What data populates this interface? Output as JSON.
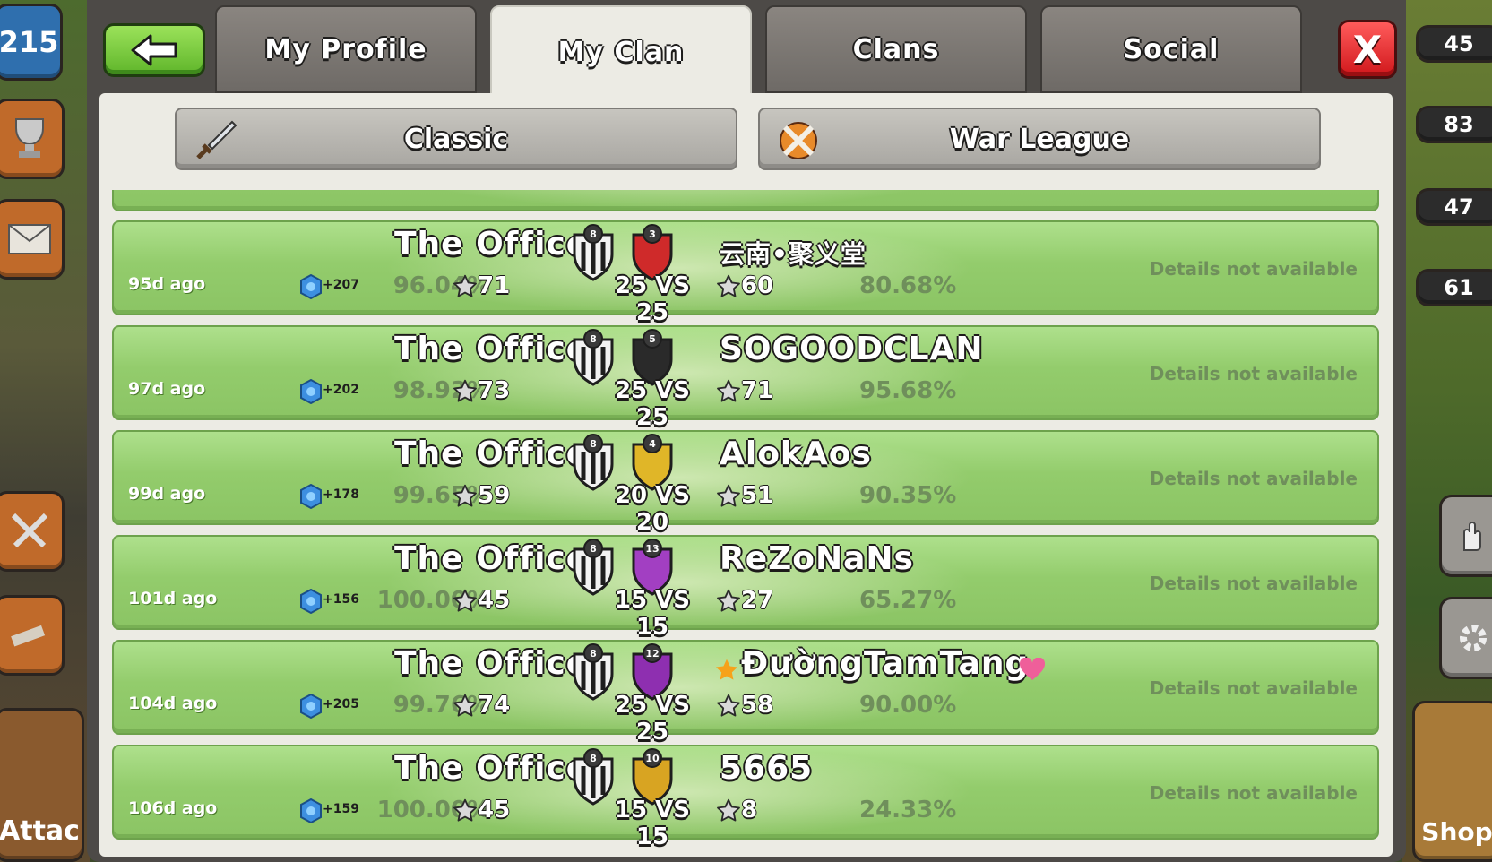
{
  "header": {
    "tabs": [
      {
        "label": "My Profile",
        "active": false
      },
      {
        "label": "My Clan",
        "active": true
      },
      {
        "label": "Clans",
        "active": false
      },
      {
        "label": "Social",
        "active": false
      }
    ],
    "close_label": "X"
  },
  "side_left": {
    "trophies_partial": "215",
    "attack_label_partial": "Attac"
  },
  "side_right": {
    "values_partial": [
      "45",
      "83",
      "47",
      "61"
    ],
    "shop_label_partial": "Shop"
  },
  "subtabs": [
    {
      "label": "Classic",
      "icon": "sword-icon"
    },
    {
      "label": "War League",
      "icon": "crossed-swords-icon"
    }
  ],
  "wars": [
    {
      "ago": "95d ago",
      "our_name": "The Office",
      "our_level": "8",
      "opp_name": "云南•聚义堂",
      "opp_level": "3",
      "size": "25 VS 25",
      "xp": "+207",
      "our_pct": "96.04%",
      "our_stars": "71",
      "opp_stars": "60",
      "opp_pct": "80.68%",
      "details": "Details not available",
      "opp_badge_color": "#cf2a2a"
    },
    {
      "ago": "97d ago",
      "our_name": "The Office",
      "our_level": "8",
      "opp_name": "SOGOODCLAN",
      "opp_level": "5",
      "size": "25 VS 25",
      "xp": "+202",
      "our_pct": "98.92%",
      "our_stars": "73",
      "opp_stars": "71",
      "opp_pct": "95.68%",
      "details": "Details not available",
      "opp_badge_color": "#2a2a2a"
    },
    {
      "ago": "99d ago",
      "our_name": "The Office",
      "our_level": "8",
      "opp_name": "AlokAos",
      "opp_level": "4",
      "size": "20 VS 20",
      "xp": "+178",
      "our_pct": "99.65%",
      "our_stars": "59",
      "opp_stars": "51",
      "opp_pct": "90.35%",
      "details": "Details not available",
      "opp_badge_color": "#e0b628"
    },
    {
      "ago": "101d ago",
      "our_name": "The Office",
      "our_level": "8",
      "opp_name": "ReZoNaNs",
      "opp_level": "13",
      "size": "15 VS 15",
      "xp": "+156",
      "our_pct": "100.00%",
      "our_stars": "45",
      "opp_stars": "27",
      "opp_pct": "65.27%",
      "details": "Details not available",
      "opp_badge_color": "#a23fc2"
    },
    {
      "ago": "104d ago",
      "our_name": "The Office",
      "our_level": "8",
      "opp_name": "ĐườngTamTang",
      "opp_level": "12",
      "size": "25 VS 25",
      "xp": "+205",
      "our_pct": "99.76%",
      "our_stars": "74",
      "opp_stars": "58",
      "opp_pct": "90.00%",
      "details": "Details not available",
      "opp_badge_color": "#8e2fb0"
    },
    {
      "ago": "106d ago",
      "our_name": "The Office",
      "our_level": "8",
      "opp_name": "5665",
      "opp_level": "10",
      "size": "15 VS 15",
      "xp": "+159",
      "our_pct": "100.00%",
      "our_stars": "45",
      "opp_stars": "8",
      "opp_pct": "24.33%",
      "details": "Details not available",
      "opp_badge_color": "#d8a422"
    }
  ]
}
